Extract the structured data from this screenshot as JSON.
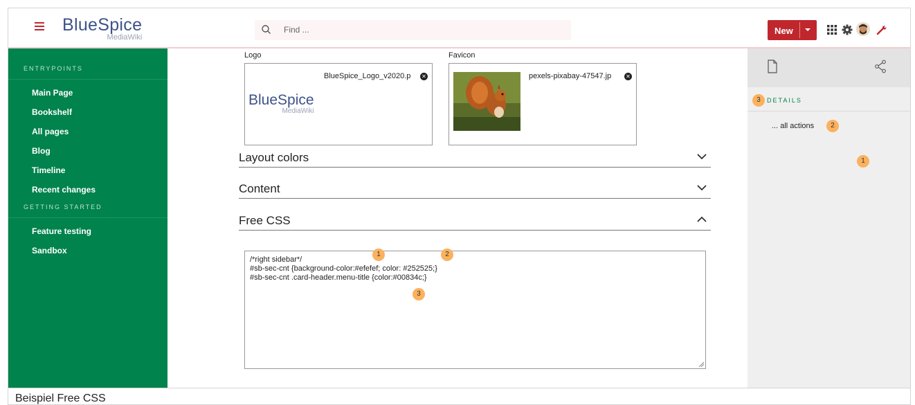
{
  "header": {
    "logo_main": "BlueSpice",
    "logo_sub": "MediaWiki",
    "search_placeholder": "Find ...",
    "new_button": "New"
  },
  "sidebar": {
    "section1": "ENTRYPOINTS",
    "items1": [
      "Main Page",
      "Bookshelf",
      "All pages",
      "Blog",
      "Timeline",
      "Recent changes"
    ],
    "section2": "GETTING STARTED",
    "items2": [
      "Feature testing",
      "Sandbox"
    ]
  },
  "main": {
    "logo_label": "Logo",
    "logo_file": "BlueSpice_Logo_v2020.p",
    "logo_preview_main": "BlueSpice",
    "logo_preview_sub": "MediaWiki",
    "favicon_label": "Favicon",
    "favicon_file": "pexels-pixabay-47547.jp",
    "sections": [
      "Layout colors",
      "Content",
      "Free CSS"
    ],
    "css_lines": [
      "/*right sidebar*/",
      "#sb-sec-cnt {background-color:#efefef; color: #252525;}",
      "#sb-sec-cnt .card-header.menu-title {color:#00834c;}"
    ]
  },
  "rightbar": {
    "details": "DETAILS",
    "all_actions": "... all actions"
  },
  "badges": [
    "1",
    "2",
    "3"
  ],
  "caption": "Beispiel Free CSS",
  "colors": {
    "accent_green": "#00834c",
    "brand_red": "#c0272d",
    "badge_orange": "#fbb15e"
  }
}
